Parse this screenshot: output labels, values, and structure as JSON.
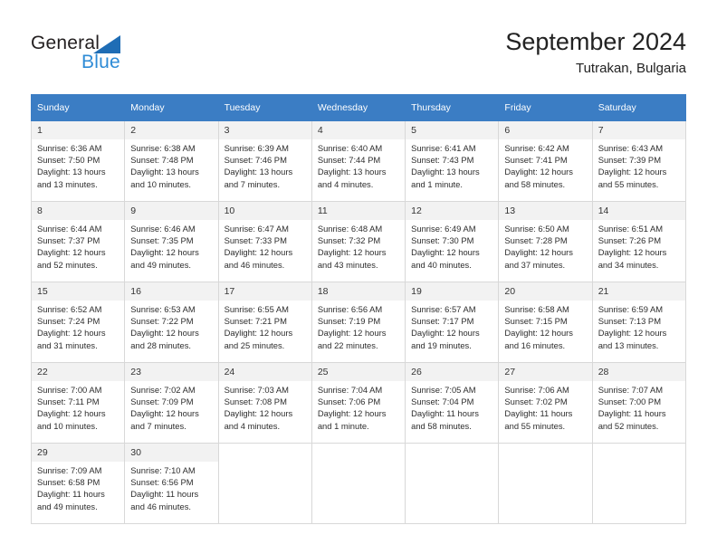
{
  "brand": {
    "name_part1": "General",
    "name_part2": "Blue",
    "triangle_color": "#1f6db5",
    "blue_color": "#2e8bd6"
  },
  "header": {
    "title": "September 2024",
    "subtitle": "Tutrakan, Bulgaria"
  },
  "theme": {
    "header_bg": "#3b7dc4",
    "header_text": "#ffffff",
    "daynum_bg": "#f2f2f2",
    "grid_border": "#d8d8d8"
  },
  "weekdays": [
    "Sunday",
    "Monday",
    "Tuesday",
    "Wednesday",
    "Thursday",
    "Friday",
    "Saturday"
  ],
  "labels": {
    "sunrise": "Sunrise:",
    "sunset": "Sunset:",
    "daylight": "Daylight:"
  },
  "days": [
    {
      "num": "1",
      "sunrise": "Sunrise: 6:36 AM",
      "sunset": "Sunset: 7:50 PM",
      "daylight": "Daylight: 13 hours and 13 minutes."
    },
    {
      "num": "2",
      "sunrise": "Sunrise: 6:38 AM",
      "sunset": "Sunset: 7:48 PM",
      "daylight": "Daylight: 13 hours and 10 minutes."
    },
    {
      "num": "3",
      "sunrise": "Sunrise: 6:39 AM",
      "sunset": "Sunset: 7:46 PM",
      "daylight": "Daylight: 13 hours and 7 minutes."
    },
    {
      "num": "4",
      "sunrise": "Sunrise: 6:40 AM",
      "sunset": "Sunset: 7:44 PM",
      "daylight": "Daylight: 13 hours and 4 minutes."
    },
    {
      "num": "5",
      "sunrise": "Sunrise: 6:41 AM",
      "sunset": "Sunset: 7:43 PM",
      "daylight": "Daylight: 13 hours and 1 minute."
    },
    {
      "num": "6",
      "sunrise": "Sunrise: 6:42 AM",
      "sunset": "Sunset: 7:41 PM",
      "daylight": "Daylight: 12 hours and 58 minutes."
    },
    {
      "num": "7",
      "sunrise": "Sunrise: 6:43 AM",
      "sunset": "Sunset: 7:39 PM",
      "daylight": "Daylight: 12 hours and 55 minutes."
    },
    {
      "num": "8",
      "sunrise": "Sunrise: 6:44 AM",
      "sunset": "Sunset: 7:37 PM",
      "daylight": "Daylight: 12 hours and 52 minutes."
    },
    {
      "num": "9",
      "sunrise": "Sunrise: 6:46 AM",
      "sunset": "Sunset: 7:35 PM",
      "daylight": "Daylight: 12 hours and 49 minutes."
    },
    {
      "num": "10",
      "sunrise": "Sunrise: 6:47 AM",
      "sunset": "Sunset: 7:33 PM",
      "daylight": "Daylight: 12 hours and 46 minutes."
    },
    {
      "num": "11",
      "sunrise": "Sunrise: 6:48 AM",
      "sunset": "Sunset: 7:32 PM",
      "daylight": "Daylight: 12 hours and 43 minutes."
    },
    {
      "num": "12",
      "sunrise": "Sunrise: 6:49 AM",
      "sunset": "Sunset: 7:30 PM",
      "daylight": "Daylight: 12 hours and 40 minutes."
    },
    {
      "num": "13",
      "sunrise": "Sunrise: 6:50 AM",
      "sunset": "Sunset: 7:28 PM",
      "daylight": "Daylight: 12 hours and 37 minutes."
    },
    {
      "num": "14",
      "sunrise": "Sunrise: 6:51 AM",
      "sunset": "Sunset: 7:26 PM",
      "daylight": "Daylight: 12 hours and 34 minutes."
    },
    {
      "num": "15",
      "sunrise": "Sunrise: 6:52 AM",
      "sunset": "Sunset: 7:24 PM",
      "daylight": "Daylight: 12 hours and 31 minutes."
    },
    {
      "num": "16",
      "sunrise": "Sunrise: 6:53 AM",
      "sunset": "Sunset: 7:22 PM",
      "daylight": "Daylight: 12 hours and 28 minutes."
    },
    {
      "num": "17",
      "sunrise": "Sunrise: 6:55 AM",
      "sunset": "Sunset: 7:21 PM",
      "daylight": "Daylight: 12 hours and 25 minutes."
    },
    {
      "num": "18",
      "sunrise": "Sunrise: 6:56 AM",
      "sunset": "Sunset: 7:19 PM",
      "daylight": "Daylight: 12 hours and 22 minutes."
    },
    {
      "num": "19",
      "sunrise": "Sunrise: 6:57 AM",
      "sunset": "Sunset: 7:17 PM",
      "daylight": "Daylight: 12 hours and 19 minutes."
    },
    {
      "num": "20",
      "sunrise": "Sunrise: 6:58 AM",
      "sunset": "Sunset: 7:15 PM",
      "daylight": "Daylight: 12 hours and 16 minutes."
    },
    {
      "num": "21",
      "sunrise": "Sunrise: 6:59 AM",
      "sunset": "Sunset: 7:13 PM",
      "daylight": "Daylight: 12 hours and 13 minutes."
    },
    {
      "num": "22",
      "sunrise": "Sunrise: 7:00 AM",
      "sunset": "Sunset: 7:11 PM",
      "daylight": "Daylight: 12 hours and 10 minutes."
    },
    {
      "num": "23",
      "sunrise": "Sunrise: 7:02 AM",
      "sunset": "Sunset: 7:09 PM",
      "daylight": "Daylight: 12 hours and 7 minutes."
    },
    {
      "num": "24",
      "sunrise": "Sunrise: 7:03 AM",
      "sunset": "Sunset: 7:08 PM",
      "daylight": "Daylight: 12 hours and 4 minutes."
    },
    {
      "num": "25",
      "sunrise": "Sunrise: 7:04 AM",
      "sunset": "Sunset: 7:06 PM",
      "daylight": "Daylight: 12 hours and 1 minute."
    },
    {
      "num": "26",
      "sunrise": "Sunrise: 7:05 AM",
      "sunset": "Sunset: 7:04 PM",
      "daylight": "Daylight: 11 hours and 58 minutes."
    },
    {
      "num": "27",
      "sunrise": "Sunrise: 7:06 AM",
      "sunset": "Sunset: 7:02 PM",
      "daylight": "Daylight: 11 hours and 55 minutes."
    },
    {
      "num": "28",
      "sunrise": "Sunrise: 7:07 AM",
      "sunset": "Sunset: 7:00 PM",
      "daylight": "Daylight: 11 hours and 52 minutes."
    },
    {
      "num": "29",
      "sunrise": "Sunrise: 7:09 AM",
      "sunset": "Sunset: 6:58 PM",
      "daylight": "Daylight: 11 hours and 49 minutes."
    },
    {
      "num": "30",
      "sunrise": "Sunrise: 7:10 AM",
      "sunset": "Sunset: 6:56 PM",
      "daylight": "Daylight: 11 hours and 46 minutes."
    }
  ],
  "grid": {
    "leading_blanks": 0,
    "trailing_blanks": 5,
    "columns": 7,
    "rows": 5
  }
}
